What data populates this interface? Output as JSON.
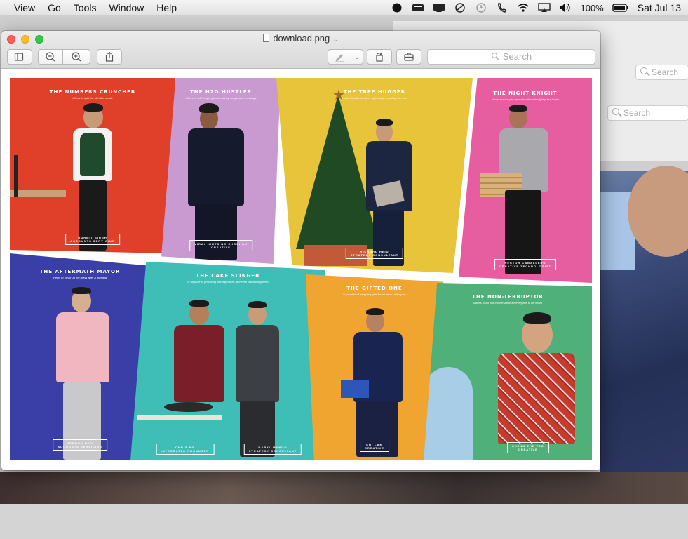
{
  "menubar": {
    "items": [
      "View",
      "Go",
      "Tools",
      "Window",
      "Help"
    ],
    "battery": "100%",
    "clock": "Sat Jul 13"
  },
  "background": {
    "search_1": "Search",
    "search_2": "Search"
  },
  "window": {
    "title": "download.png",
    "search_placeholder": "Search"
  },
  "collage": {
    "panels": [
      {
        "title": "THE NUMBERS CRUNCHER",
        "subtitle": "Offers to split the bill after meals",
        "name": "GURMIT SINGH\nACCOUNTS SERVICING",
        "color": "#e0402a"
      },
      {
        "title": "THE H2O HUSTLER",
        "subtitle": "Offers to refill empty glasses during long-drawn meetings",
        "name": "VIRAJ KIRTSING CHOUHAN\nCREATIVE",
        "color": "#c89ad0"
      },
      {
        "title": "THE TREE HUGGER",
        "subtitle": "Leads Christmas cheer by helping to pull up the tree",
        "name": "RICHARD REID\nSTRATEGY CONSULTANT",
        "color": "#e7c43a"
      },
      {
        "title": "THE NIGHT KNIGHT",
        "subtitle": "Never too busy to help clear the late-night pizza boxes",
        "name": "HECTOR CABALLERO\nCREATIVE TECHNOLOGIST",
        "color": "#e65da0"
      },
      {
        "title": "THE AFTERMATH MAYOR",
        "subtitle": "Helps to clean up the mess after a meeting",
        "name": "VERNON NEO\nACCOUNTS SERVICING",
        "color": "#3a3fa8"
      },
      {
        "title": "THE CAKE SLINGER",
        "subtitle": "Is capable of procuring birthday cakes and even distributing them",
        "name": "CHRIS NG\nINTEGRATED PRODUCER",
        "name2": "DARYL MANGO\nSTRATEGY CONSULTANT",
        "color": "#3fbdb7"
      },
      {
        "title": "THE GIFTED ONE",
        "subtitle": "Is capable of wrapping gifts for his dear colleagues",
        "name": "CHI LAM\nCREATIVE",
        "color": "#f0a530"
      },
      {
        "title": "THE NON-TERRUPTOR",
        "subtitle": "Makes room in a conversation for everyone to be heard",
        "name": "CHENG ZHE YAO\nCREATIVE",
        "color": "#4fb07a"
      }
    ]
  }
}
